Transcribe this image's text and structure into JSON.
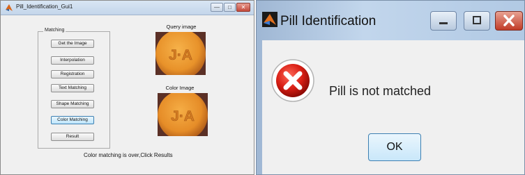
{
  "gui_window": {
    "title": "Pill_Identification_Gui1",
    "controls": {
      "minimize": "—",
      "maximize": "□",
      "close": "✕"
    },
    "panel_title": "Matching",
    "buttons": [
      "Get the Image",
      "Interpolation",
      "Registration",
      "Text Matching",
      "Shape Matching",
      "Color Matching",
      "Result"
    ],
    "active_button": "Color Matching",
    "query_label": "Query image",
    "color_label": "Color Image",
    "pill_imprint": "J·A",
    "status": "Color matching is over,Click Results"
  },
  "dialog": {
    "title": "Pill Identification",
    "message": "Pill is not matched",
    "ok_label": "OK",
    "icon": "error-icon",
    "accent": "#cc1f1f"
  }
}
